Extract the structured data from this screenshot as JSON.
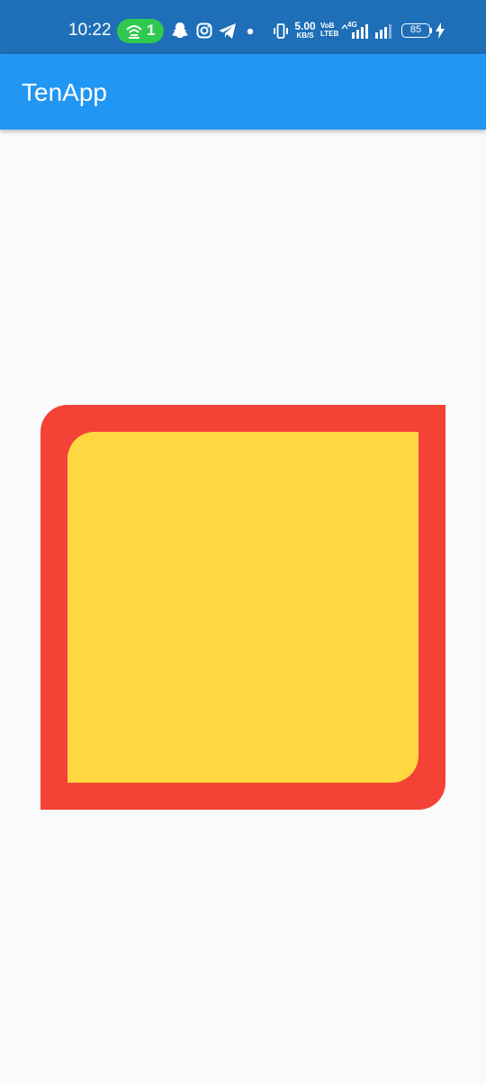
{
  "status_bar": {
    "time": "10:22",
    "hotspot_count": "1",
    "net_speed_value": "5.00",
    "net_speed_unit": "KB/S",
    "volte_top": "VoB",
    "volte_bottom": "LTEB",
    "network_type": "4G",
    "battery_level": "85",
    "icons": [
      "hotspot-icon",
      "snapchat-icon",
      "instagram-icon",
      "telegram-icon",
      "notification-dot-icon",
      "vibrate-icon",
      "signal-icon",
      "signal-icon",
      "charging-icon"
    ]
  },
  "app_bar": {
    "title": "TenApp"
  },
  "colors": {
    "status_bar": "#1e6fb8",
    "app_bar": "#2196f3",
    "outer_box": "#f44336",
    "inner_box": "#ffd740",
    "background": "#fafafa",
    "hotspot_pill": "#2ec94e"
  }
}
